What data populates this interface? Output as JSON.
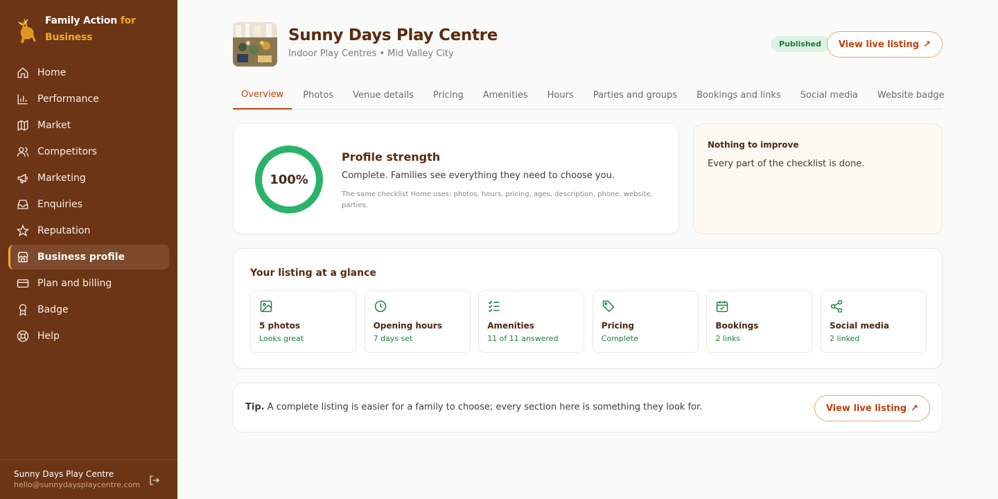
{
  "brand": {
    "line1": "Family Action",
    "accent1": "for",
    "accent2": "Business"
  },
  "nav": [
    {
      "label": "Home",
      "icon": "home-icon"
    },
    {
      "label": "Performance",
      "icon": "bar-chart-icon"
    },
    {
      "label": "Market",
      "icon": "map-icon"
    },
    {
      "label": "Competitors",
      "icon": "users-icon"
    },
    {
      "label": "Marketing",
      "icon": "megaphone-icon"
    },
    {
      "label": "Enquiries",
      "icon": "inbox-icon"
    },
    {
      "label": "Reputation",
      "icon": "star-icon"
    },
    {
      "label": "Business profile",
      "icon": "store-icon",
      "active": true
    },
    {
      "label": "Plan and billing",
      "icon": "credit-card-icon"
    },
    {
      "label": "Badge",
      "icon": "award-icon"
    },
    {
      "label": "Help",
      "icon": "help-lifebuoy-icon"
    }
  ],
  "account": {
    "name": "Sunny Days Play Centre",
    "email": "hello@sunnydaysplaycentre.com"
  },
  "header": {
    "title": "Sunny Days Play Centre",
    "subtitle": "Indoor Play Centres • Mid Valley City",
    "status": "Published",
    "view_live_label": "View live listing",
    "arrow": "↗"
  },
  "tabs": [
    {
      "label": "Overview",
      "active": true
    },
    {
      "label": "Photos"
    },
    {
      "label": "Venue details"
    },
    {
      "label": "Pricing"
    },
    {
      "label": "Amenities"
    },
    {
      "label": "Hours"
    },
    {
      "label": "Parties and groups"
    },
    {
      "label": "Bookings and links"
    },
    {
      "label": "Social media"
    },
    {
      "label": "Website badge"
    }
  ],
  "strength": {
    "percent_label": "100%",
    "percent": 100,
    "title": "Profile strength",
    "description": "Complete. Families see everything they need to choose you.",
    "note": "The same checklist Home uses: photos, hours, pricing, ages, description, phone, website, parties."
  },
  "improve": {
    "title": "Nothing to improve",
    "text": "Every part of the checklist is done."
  },
  "glance": {
    "title": "Your listing at a glance",
    "tiles": [
      {
        "title": "5 photos",
        "sub": "Looks great",
        "icon": "image-icon"
      },
      {
        "title": "Opening hours",
        "sub": "7 days set",
        "icon": "clock-icon"
      },
      {
        "title": "Amenities",
        "sub": "11 of 11 answered",
        "icon": "checklist-icon"
      },
      {
        "title": "Pricing",
        "sub": "Complete",
        "icon": "tag-icon"
      },
      {
        "title": "Bookings",
        "sub": "2 links",
        "icon": "calendar-check-icon"
      },
      {
        "title": "Social media",
        "sub": "2 linked",
        "icon": "share-icon"
      }
    ]
  },
  "tip": {
    "lead": "Tip.",
    "text": "A complete listing is easier for a family to choose; every section here is something they look for.",
    "button": "View live listing",
    "arrow": "↗"
  },
  "colors": {
    "sidebar": "#6b3516",
    "accent": "#f7a823",
    "primary": "#c2410c",
    "success": "#2ab36a"
  }
}
